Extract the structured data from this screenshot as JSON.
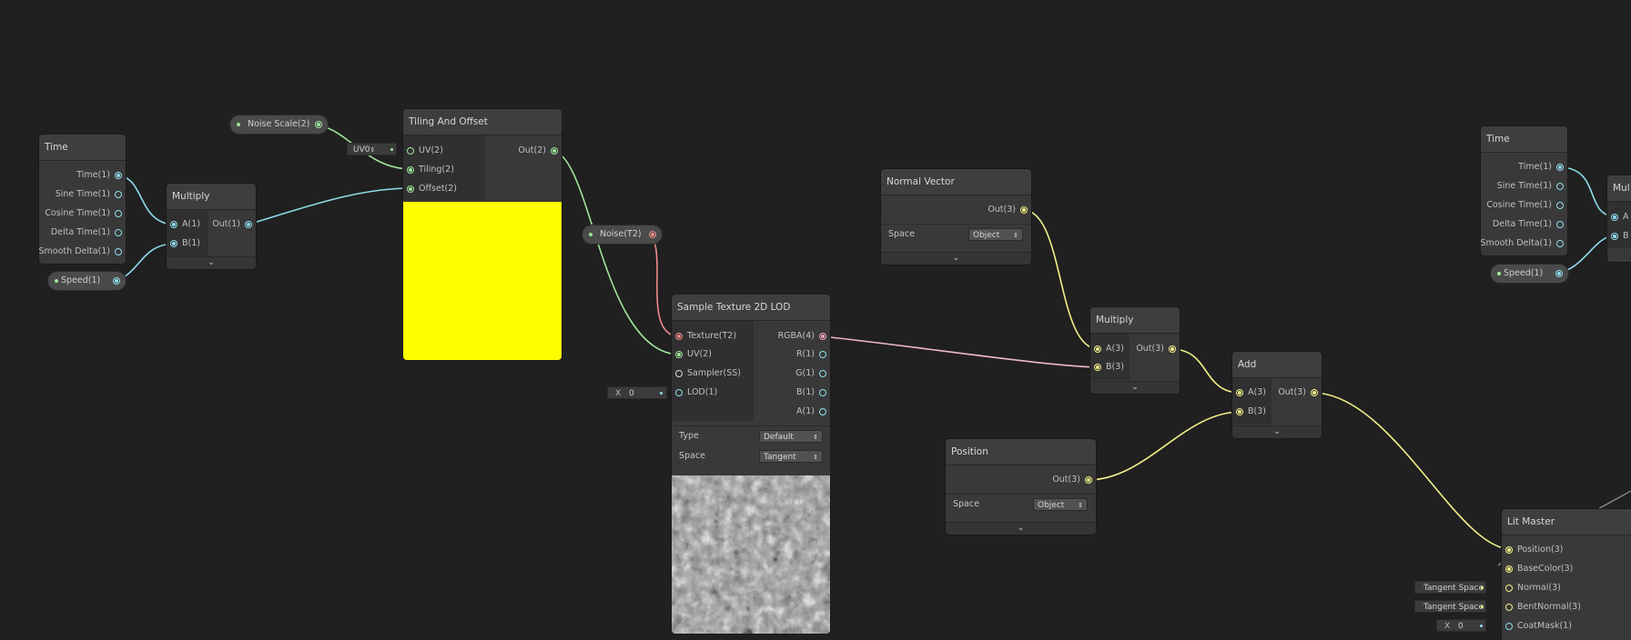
{
  "nodes": {
    "time_left": {
      "title": "Time",
      "outputs": [
        "Time(1)",
        "Sine Time(1)",
        "Cosine Time(1)",
        "Delta Time(1)",
        "Smooth Delta(1)"
      ]
    },
    "multiply_left": {
      "title": "Multiply",
      "inputs": [
        "A(1)",
        "B(1)"
      ],
      "output": "Out(1)"
    },
    "tiling": {
      "title": "Tiling And Offset",
      "inputs": [
        "UV(2)",
        "Tiling(2)",
        "Offset(2)"
      ],
      "output": "Out(2)",
      "uv_field": "UV0"
    },
    "sample_tex": {
      "title": "Sample Texture 2D LOD",
      "inputs": [
        "Texture(T2)",
        "UV(2)",
        "Sampler(SS)",
        "LOD(1)"
      ],
      "outputs": [
        "RGBA(4)",
        "R(1)",
        "G(1)",
        "B(1)",
        "A(1)"
      ],
      "type_label": "Type",
      "type_value": "Default",
      "space_label": "Space",
      "space_value": "Tangent",
      "lod_field_axis": "X",
      "lod_field_value": "0"
    },
    "normal_vector": {
      "title": "Normal Vector",
      "output": "Out(3)",
      "space_label": "Space",
      "space_value": "Object"
    },
    "multiply_mid": {
      "title": "Multiply",
      "inputs": [
        "A(3)",
        "B(3)"
      ],
      "output": "Out(3)"
    },
    "add": {
      "title": "Add",
      "inputs": [
        "A(3)",
        "B(3)"
      ],
      "output": "Out(3)"
    },
    "position": {
      "title": "Position",
      "output": "Out(3)",
      "space_label": "Space",
      "space_value": "Object"
    },
    "time_right": {
      "title": "Time",
      "outputs": [
        "Time(1)",
        "Sine Time(1)",
        "Cosine Time(1)",
        "Delta Time(1)",
        "Smooth Delta(1)"
      ]
    },
    "multiply_right": {
      "title": "Mul",
      "inputs": [
        "A",
        "B"
      ]
    },
    "lit_master": {
      "title": "Lit Master",
      "inputs": [
        "Position(3)",
        "BaseColor(3)",
        "Normal(3)",
        "BentNormal(3)",
        "CoatMask(1)"
      ],
      "normal_field": "Tangent Space",
      "bent_field": "Tangent Space",
      "coat_axis": "X",
      "coat_value": "0"
    }
  },
  "properties": {
    "noise_scale": "Noise Scale(2)",
    "speed_left": "Speed(1)",
    "noise": "Noise(T2)",
    "speed_right": "Speed(1)"
  },
  "icons": {
    "collapse": "chevron-down-icon",
    "dropdown": "updown-arrow-icon"
  },
  "colors": {
    "background": "#202020",
    "float_port": "#8fdcec",
    "vector2_port": "#9fe59a",
    "vector3_port": "#f2f08a",
    "texture_port": "#f08a8a",
    "vector4_port": "#f0a0c8",
    "preview_yellow": "#ffff00"
  }
}
